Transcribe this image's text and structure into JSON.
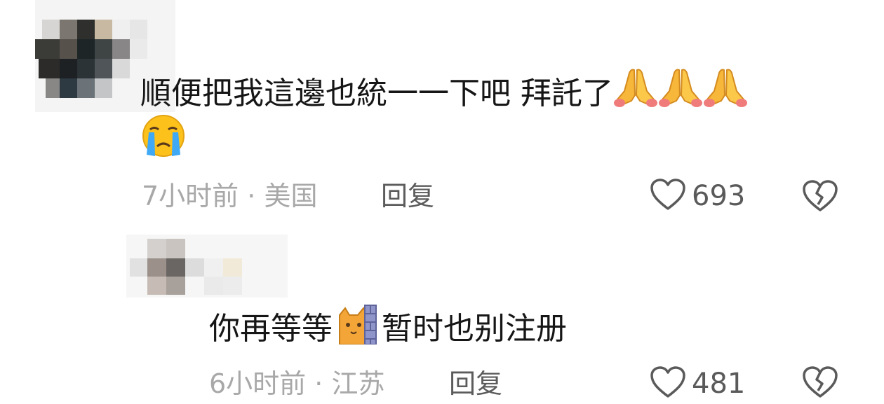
{
  "comments": [
    {
      "text_line1": "順便把我這邊也統一一下吧 拜託了",
      "text_line2": "",
      "emojis": [
        "folded-hands",
        "folded-hands",
        "folded-hands",
        "crying-face"
      ],
      "time": "7小时前",
      "separator": "·",
      "location": "美国",
      "reply_label": "回复",
      "like_count": "693"
    },
    {
      "text_before_emoji": "你再等等",
      "text_after_emoji": "暂时也别注册",
      "emojis": [
        "cat-behind-wall"
      ],
      "time": "6小时前",
      "separator": "·",
      "location": "江苏",
      "reply_label": "回复",
      "like_count": "481"
    }
  ],
  "colors": {
    "text": "#161616",
    "meta": "#a8a8a8",
    "reply": "#5c5c5c",
    "icon": "#5a5a5a"
  }
}
